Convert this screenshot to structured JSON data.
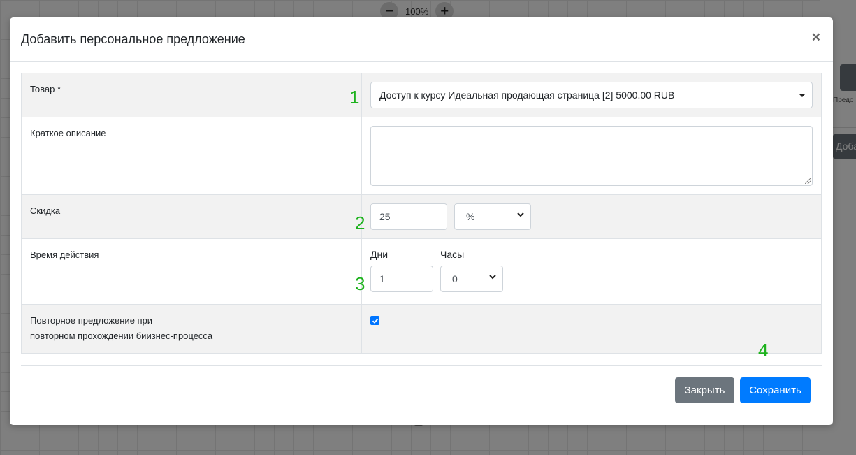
{
  "background": {
    "zoom": {
      "minus": "−",
      "level": "100%",
      "plus": "+"
    },
    "side_label": "Предо",
    "side_button": "Доба"
  },
  "modal": {
    "title": "Добавить персональное предложение",
    "close_symbol": "×"
  },
  "form": {
    "product": {
      "label": "Товар *",
      "selected": "Доступ к курсу Идеальная продающая страница [2] 5000.00 RUB"
    },
    "description": {
      "label": "Краткое описание",
      "value": ""
    },
    "discount": {
      "label": "Скидка",
      "value": "25",
      "unit": "%"
    },
    "validity": {
      "label": "Время действия",
      "days_label": "Дни",
      "days_value": "1",
      "hours_label": "Часы",
      "hours_value": "0"
    },
    "repeat": {
      "label_line1": "Повторное предложение при",
      "label_line2": "повторном прохождении биизнес-процесса",
      "checked": true
    }
  },
  "annotations": {
    "a1": "1",
    "a2": "2",
    "a3": "3",
    "a4": "4"
  },
  "buttons": {
    "close": "Закрыть",
    "save": "Сохранить"
  },
  "colors": {
    "primary": "#007bff",
    "secondary": "#6c757d",
    "annotation": "#1db21d",
    "checkbox": "#0075ff"
  }
}
